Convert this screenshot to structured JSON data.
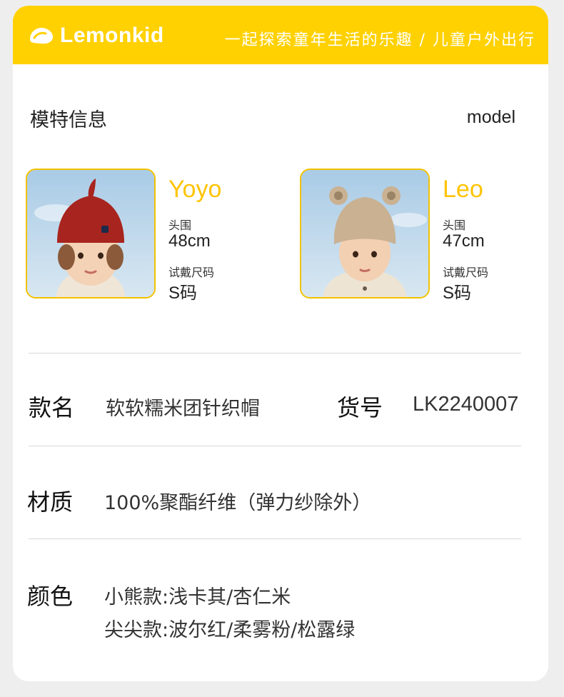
{
  "header": {
    "brand_name": "Lemonkid",
    "slogan": "一起探索童年生活的乐趣 / 儿童户外出行"
  },
  "models_section": {
    "title": "模特信息",
    "title_en": "model",
    "head_label": "头围",
    "size_label": "试戴尺码",
    "models": [
      {
        "name": "Yoyo",
        "head": "48cm",
        "size": "S码",
        "hat_color": "#a8241e"
      },
      {
        "name": "Leo",
        "head": "47cm",
        "size": "S码",
        "hat_color": "#c9b192"
      }
    ]
  },
  "product": {
    "style_label": "款名",
    "style_value": "软软糯米团针织帽",
    "sku_label": "货号",
    "sku_value": "LK2240007",
    "material_label": "材质",
    "material_value": "100%聚酯纤维（弹力纱除外）",
    "color_label": "颜色",
    "color_lines": [
      "小熊款:浅卡其/杏仁米",
      "尖尖款:波尔红/柔雾粉/松露绿"
    ]
  },
  "colors": {
    "accent": "#ffd100",
    "name_yellow": "#ffc400",
    "background": "#eeeeee"
  }
}
